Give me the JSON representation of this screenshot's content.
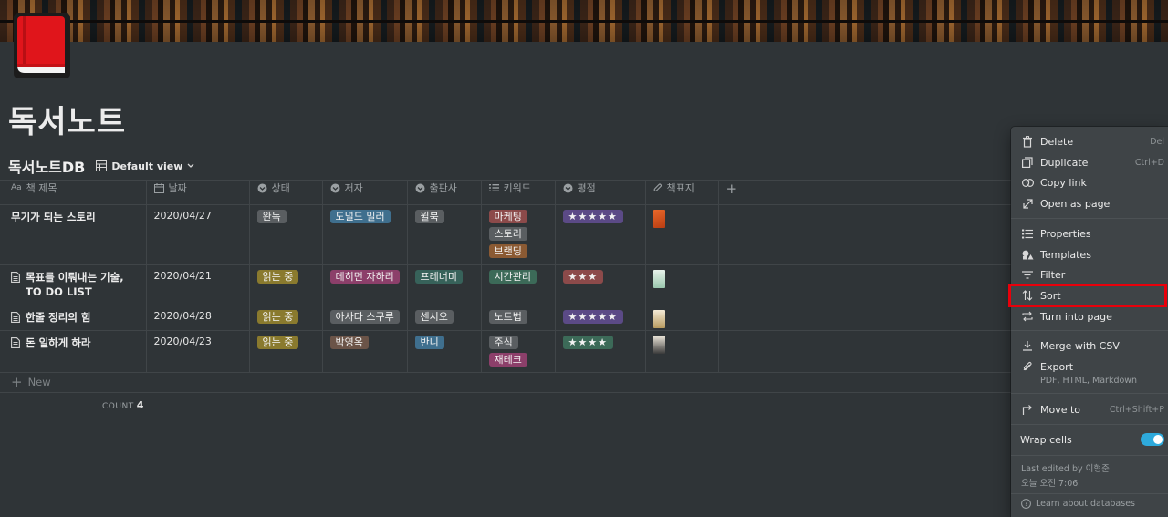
{
  "page": {
    "title": "독서노트",
    "icon": "red-book-icon"
  },
  "database": {
    "title": "독서노트DB",
    "view_label": "Default view",
    "columns": [
      {
        "label": "책 제목",
        "icon": "title-icon"
      },
      {
        "label": "날짜",
        "icon": "calendar-icon"
      },
      {
        "label": "상태",
        "icon": "select-icon"
      },
      {
        "label": "저자",
        "icon": "select-icon"
      },
      {
        "label": "출판사",
        "icon": "select-icon"
      },
      {
        "label": "키워드",
        "icon": "list-icon"
      },
      {
        "label": "평점",
        "icon": "select-icon"
      },
      {
        "label": "책표지",
        "icon": "paperclip-icon"
      }
    ],
    "rows": [
      {
        "title": "무기가 되는 스토리",
        "date": "2020/04/27",
        "status": "완독",
        "author": "도널드 밀러",
        "publisher": "윌북",
        "keywords": [
          "마케팅",
          "스토리",
          "브랜딩"
        ],
        "rating": "★★★★★",
        "cover_color": "#d4561e"
      },
      {
        "title": "목표를 이뤄내는 기술, TO DO LIST",
        "date": "2020/04/21",
        "status": "읽는 중",
        "author": "데히먼 자하리",
        "publisher": "프레너미",
        "keywords": [
          "시간관리"
        ],
        "rating": "★★★",
        "cover_color": "#cfe3d6"
      },
      {
        "title": "한줄 정리의 힘",
        "date": "2020/04/28",
        "status": "읽는 중",
        "author": "아사다 스구루",
        "publisher": "센시오",
        "keywords": [
          "노트법"
        ],
        "rating": "★★★★★",
        "cover_color": "#e8dcc0"
      },
      {
        "title": "돈 일하게 하라",
        "date": "2020/04/23",
        "status": "읽는 중",
        "author": "박영옥",
        "publisher": "반니",
        "keywords": [
          "주식",
          "재테크"
        ],
        "rating": "★★★★",
        "cover_color": "#d8d2c4"
      }
    ],
    "new_label": "New",
    "count_label": "COUNT",
    "count_value": "4"
  },
  "menu": {
    "items": [
      {
        "label": "Delete",
        "shortcut": "Del",
        "icon": "trash-icon"
      },
      {
        "label": "Duplicate",
        "shortcut": "Ctrl+D",
        "icon": "duplicate-icon"
      },
      {
        "label": "Copy link",
        "shortcut": "",
        "icon": "link-icon"
      },
      {
        "label": "Open as page",
        "shortcut": "",
        "icon": "open-page-icon"
      },
      {
        "label": "Properties",
        "shortcut": "",
        "icon": "properties-icon"
      },
      {
        "label": "Templates",
        "shortcut": "",
        "icon": "templates-icon"
      },
      {
        "label": "Filter",
        "shortcut": "",
        "icon": "filter-icon"
      },
      {
        "label": "Sort",
        "shortcut": "",
        "icon": "sort-icon"
      },
      {
        "label": "Turn into page",
        "shortcut": "",
        "icon": "turn-into-icon"
      },
      {
        "label": "Merge with CSV",
        "shortcut": "",
        "icon": "merge-icon"
      },
      {
        "label": "Export",
        "shortcut": "",
        "icon": "export-icon"
      },
      {
        "label": "Move to",
        "shortcut": "Ctrl+Shift+P",
        "icon": "move-to-icon"
      }
    ],
    "export_sub": "PDF, HTML, Markdown",
    "wrap_cells_label": "Wrap cells",
    "wrap_cells_on": true,
    "last_edited": "Last edited by 이형준",
    "last_edited_time": "오늘 오전 7:06",
    "learn_label": "Learn about databases"
  }
}
